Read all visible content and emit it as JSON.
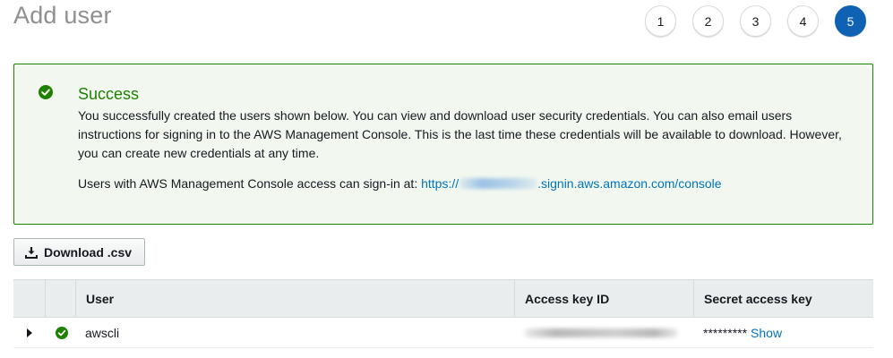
{
  "page": {
    "title": "Add user"
  },
  "steps": [
    "1",
    "2",
    "3",
    "4",
    "5"
  ],
  "active_step": "5",
  "alert": {
    "title": "Success",
    "body": "You successfully created the users shown below. You can view and download user security credentials. You can also email users instructions for signing in to the AWS Management Console. This is the last time these credentials will be available to download. However, you can create new credentials at any time.",
    "signin_prefix": "Users with AWS Management Console access can sign-in at:",
    "signin_link_start": "https://",
    "signin_link_end": ".signin.aws.amazon.com/console",
    "icon": "check-circle-icon",
    "color": "#1d8102"
  },
  "toolbar": {
    "download_label": "Download .csv",
    "download_icon": "download-icon"
  },
  "table": {
    "headers": {
      "user": "User",
      "access_key": "Access key ID",
      "secret": "Secret access key"
    },
    "rows": [
      {
        "user": "awscli",
        "secret_masked": "*********",
        "show_label": "Show"
      }
    ]
  },
  "colors": {
    "accent": "#0073bb",
    "active_step": "#0f62b3",
    "success": "#1d8102"
  }
}
